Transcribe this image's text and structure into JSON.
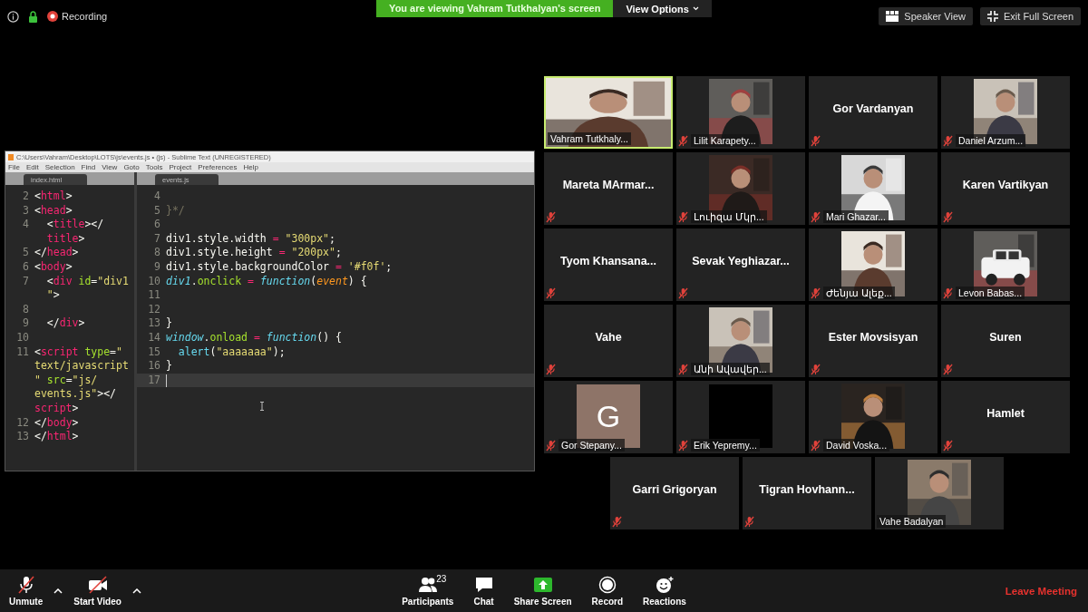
{
  "top_bar": {
    "recording_label": "Recording",
    "banner": "You are viewing Vahram Tutkhalyan's screen",
    "view_options": "View Options",
    "buttons": [
      {
        "kind": "speaker",
        "label": "Speaker View"
      },
      {
        "kind": "fullscreen",
        "label": "Exit Full Screen"
      }
    ]
  },
  "editor": {
    "title": "C:\\Users\\Vahram\\Desktop\\LOTS\\js\\events.js • (js) - Sublime Text (UNREGISTERED)",
    "menu": [
      "File",
      "Edit",
      "Selection",
      "Find",
      "View",
      "Goto",
      "Tools",
      "Project",
      "Preferences",
      "Help"
    ],
    "panes": [
      {
        "tab": "index.html",
        "lines": [
          {
            "num": "2",
            "tokens": [
              {
                "kind": "plain",
                "text": "<"
              },
              {
                "kind": "tag",
                "text": "html"
              },
              {
                "kind": "plain",
                "text": ">"
              }
            ]
          },
          {
            "num": "3",
            "tokens": [
              {
                "kind": "plain",
                "text": "<"
              },
              {
                "kind": "tag",
                "text": "head"
              },
              {
                "kind": "plain",
                "text": ">"
              }
            ]
          },
          {
            "num": "4",
            "tokens": [
              {
                "kind": "plain",
                "text": "  <"
              },
              {
                "kind": "tag",
                "text": "title"
              },
              {
                "kind": "plain",
                "text": "></"
              }
            ]
          },
          {
            "tokens": [
              {
                "kind": "tag",
                "text": "  title"
              },
              {
                "kind": "plain",
                "text": ">"
              }
            ]
          },
          {
            "num": "5",
            "tokens": [
              {
                "kind": "plain",
                "text": "</"
              },
              {
                "kind": "tag",
                "text": "head"
              },
              {
                "kind": "plain",
                "text": ">"
              }
            ]
          },
          {
            "num": "6",
            "tokens": [
              {
                "kind": "plain",
                "text": "<"
              },
              {
                "kind": "tag",
                "text": "body"
              },
              {
                "kind": "plain",
                "text": ">"
              }
            ]
          },
          {
            "num": "7",
            "tokens": [
              {
                "kind": "plain",
                "text": "  <"
              },
              {
                "kind": "tag",
                "text": "div"
              },
              {
                "kind": "attr",
                "text": " id"
              },
              {
                "kind": "plain",
                "text": "="
              },
              {
                "kind": "string",
                "text": "\"div1"
              }
            ]
          },
          {
            "tokens": [
              {
                "kind": "string",
                "text": "  \""
              },
              {
                "kind": "plain",
                "text": ">"
              }
            ]
          },
          {
            "num": "8"
          },
          {
            "num": "9",
            "tokens": [
              {
                "kind": "plain",
                "text": "  </"
              },
              {
                "kind": "tag",
                "text": "div"
              },
              {
                "kind": "plain",
                "text": ">"
              }
            ]
          },
          {
            "num": "10"
          },
          {
            "num": "11",
            "tokens": [
              {
                "kind": "plain",
                "text": "<"
              },
              {
                "kind": "tag",
                "text": "script"
              },
              {
                "kind": "attr",
                "text": " type"
              },
              {
                "kind": "plain",
                "text": "="
              },
              {
                "kind": "string",
                "text": "\""
              }
            ]
          },
          {
            "tokens": [
              {
                "kind": "string",
                "text": "text/javascript"
              }
            ]
          },
          {
            "tokens": [
              {
                "kind": "string",
                "text": "\""
              },
              {
                "kind": "attr",
                "text": " src"
              },
              {
                "kind": "plain",
                "text": "="
              },
              {
                "kind": "string",
                "text": "\"js/"
              }
            ]
          },
          {
            "tokens": [
              {
                "kind": "string",
                "text": "events.js\""
              },
              {
                "kind": "plain",
                "text": "></"
              }
            ]
          },
          {
            "tokens": [
              {
                "kind": "tag",
                "text": "script"
              },
              {
                "kind": "plain",
                "text": ">"
              }
            ]
          },
          {
            "num": "12",
            "tokens": [
              {
                "kind": "plain",
                "text": "</"
              },
              {
                "kind": "tag",
                "text": "body"
              },
              {
                "kind": "plain",
                "text": ">"
              }
            ]
          },
          {
            "num": "13",
            "tokens": [
              {
                "kind": "plain",
                "text": "</"
              },
              {
                "kind": "tag",
                "text": "html"
              },
              {
                "kind": "plain",
                "text": ">"
              }
            ]
          }
        ]
      },
      {
        "tab": "events.js",
        "lines": [
          {
            "num": "4"
          },
          {
            "num": "5",
            "tokens": [
              {
                "kind": "comment",
                "text": "}*/"
              }
            ]
          },
          {
            "num": "6"
          },
          {
            "num": "7",
            "tokens": [
              {
                "kind": "plain",
                "text": "div1.style.width "
              },
              {
                "kind": "op",
                "text": "="
              },
              {
                "kind": "string",
                "text": " \"300px\""
              },
              {
                "kind": "plain",
                "text": ";"
              }
            ]
          },
          {
            "num": "8",
            "tokens": [
              {
                "kind": "plain",
                "text": "div1.style.height "
              },
              {
                "kind": "op",
                "text": "="
              },
              {
                "kind": "string",
                "text": " \"200px\""
              },
              {
                "kind": "plain",
                "text": ";"
              }
            ]
          },
          {
            "num": "9",
            "tokens": [
              {
                "kind": "plain",
                "text": "div1.style.backgroundColor "
              },
              {
                "kind": "op",
                "text": "="
              },
              {
                "kind": "string",
                "text": " '#f0f'"
              },
              {
                "kind": "plain",
                "text": ";"
              }
            ]
          },
          {
            "num": "10",
            "tokens": [
              {
                "kind": "storage",
                "text": "div1"
              },
              {
                "kind": "plain",
                "text": "."
              },
              {
                "kind": "func",
                "text": "onclick"
              },
              {
                "kind": "op",
                "text": " ="
              },
              {
                "kind": "storage",
                "text": " function"
              },
              {
                "kind": "plain",
                "text": "("
              },
              {
                "kind": "param",
                "text": "event"
              },
              {
                "kind": "plain",
                "text": ") {"
              }
            ]
          },
          {
            "num": "11"
          },
          {
            "num": "12"
          },
          {
            "num": "13",
            "tokens": [
              {
                "kind": "plain",
                "text": "}"
              }
            ]
          },
          {
            "num": "14",
            "tokens": [
              {
                "kind": "storage",
                "text": "window"
              },
              {
                "kind": "plain",
                "text": "."
              },
              {
                "kind": "func",
                "text": "onload"
              },
              {
                "kind": "op",
                "text": " ="
              },
              {
                "kind": "storage",
                "text": " function"
              },
              {
                "kind": "plain",
                "text": "() {"
              }
            ]
          },
          {
            "num": "15",
            "tokens": [
              {
                "kind": "support",
                "text": "  alert"
              },
              {
                "kind": "plain",
                "text": "("
              },
              {
                "kind": "string",
                "text": "\"aaaaaaa\""
              },
              {
                "kind": "plain",
                "text": ");"
              }
            ]
          },
          {
            "num": "16",
            "tokens": [
              {
                "kind": "plain",
                "text": "}"
              }
            ]
          },
          {
            "num": "17",
            "current": true
          }
        ]
      }
    ]
  },
  "tiles": [
    {
      "kind": "video",
      "name": "Vahram Tutkhaly...",
      "muted": false,
      "speaking": true
    },
    {
      "kind": "video",
      "name": "Lilit Karapety...",
      "muted": true,
      "speaking": false
    },
    {
      "kind": "name",
      "name": "Gor Vardanyan",
      "muted": true,
      "speaking": false
    },
    {
      "kind": "video",
      "name": "Daniel Arzum...",
      "muted": true,
      "speaking": false
    },
    {
      "kind": "name",
      "name": "Mareta  MArmar...",
      "muted": true,
      "speaking": false
    },
    {
      "kind": "video",
      "name": "Լուիզա Մկր...",
      "muted": true,
      "speaking": false
    },
    {
      "kind": "video",
      "name": "Mari Ghazar...",
      "muted": true,
      "speaking": false
    },
    {
      "kind": "name",
      "name": "Karen Vartikyan",
      "muted": true,
      "speaking": false
    },
    {
      "kind": "name",
      "name": "Tyom  Khansana...",
      "muted": true,
      "speaking": false
    },
    {
      "kind": "name",
      "name": "Sevak  Yeghiazar...",
      "muted": true,
      "speaking": false
    },
    {
      "kind": "video",
      "name": "Ժենյա Ալեք...",
      "muted": true,
      "speaking": false
    },
    {
      "kind": "video",
      "name": "Levon Babas...",
      "muted": true,
      "speaking": false
    },
    {
      "kind": "name",
      "name": "Vahe",
      "muted": true,
      "speaking": false
    },
    {
      "kind": "video",
      "name": "Անի Ավավեր...",
      "muted": true,
      "speaking": false
    },
    {
      "kind": "name",
      "name": "Ester Movsisyan",
      "muted": true,
      "speaking": false
    },
    {
      "kind": "name",
      "name": "Suren",
      "muted": true,
      "speaking": false
    },
    {
      "kind": "avatar",
      "letter": "G",
      "name": "Gor Stepany...",
      "muted": true,
      "speaking": false
    },
    {
      "kind": "blank",
      "name": "Erik Yepremy...",
      "muted": true,
      "speaking": false
    },
    {
      "kind": "video",
      "name": "David Voska...",
      "muted": true,
      "speaking": false
    },
    {
      "kind": "name",
      "name": "Hamlet",
      "muted": true,
      "speaking": false
    },
    {
      "kind": "name",
      "name": "Garri Grigoryan",
      "muted": true,
      "speaking": false
    },
    {
      "kind": "name",
      "name": "Tigran  Hovhann...",
      "muted": true,
      "speaking": false
    },
    {
      "kind": "video",
      "name": "Vahe Badalyan",
      "muted": false,
      "speaking": false
    }
  ],
  "toolbar": {
    "left": [
      {
        "kind": "mic",
        "label": "Unmute"
      },
      {
        "kind": "video",
        "label": "Start Video"
      }
    ],
    "center": [
      {
        "kind": "participants",
        "label": "Participants",
        "count": "23"
      },
      {
        "kind": "chat",
        "label": "Chat"
      },
      {
        "kind": "share",
        "label": "Share Screen"
      },
      {
        "kind": "record",
        "label": "Record"
      },
      {
        "kind": "reactions",
        "label": "Reactions"
      }
    ],
    "leave": "Leave Meeting"
  }
}
